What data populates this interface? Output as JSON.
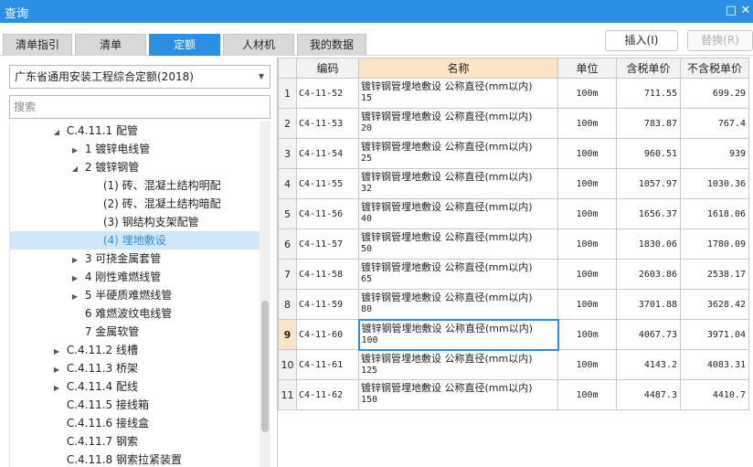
{
  "window": {
    "title": "查询",
    "restore_icon": "□",
    "close_icon": "✕"
  },
  "tabs": [
    {
      "label": "清单指引",
      "active": false
    },
    {
      "label": "清单",
      "active": false
    },
    {
      "label": "定额",
      "active": true
    },
    {
      "label": "人材机",
      "active": false
    },
    {
      "label": "我的数据",
      "active": false
    }
  ],
  "toolbar": {
    "insert_label": "插入(I)",
    "replace_label": "替换(R)"
  },
  "left_panel": {
    "quota_select": "广东省通用安装工程综合定额(2018)",
    "search_placeholder": "搜索",
    "tree": [
      {
        "toggle": "◢",
        "label": "C.4.11.1 配管",
        "level": 0,
        "selected": false
      },
      {
        "toggle": "▶",
        "label": "1 镀锌电线管",
        "level": 1,
        "selected": false
      },
      {
        "toggle": "◢",
        "label": "2 镀锌钢管",
        "level": 1,
        "selected": false
      },
      {
        "toggle": "",
        "label": "(1) 砖、混凝土结构明配",
        "level": 2,
        "selected": false
      },
      {
        "toggle": "",
        "label": "(2) 砖、混凝土结构暗配",
        "level": 2,
        "selected": false
      },
      {
        "toggle": "",
        "label": "(3) 钢结构支架配管",
        "level": 2,
        "selected": false
      },
      {
        "toggle": "",
        "label": "(4) 埋地敷设",
        "level": 2,
        "selected": true
      },
      {
        "toggle": "▶",
        "label": "3 可挠金属套管",
        "level": 1,
        "selected": false
      },
      {
        "toggle": "▶",
        "label": "4 刚性难燃线管",
        "level": 1,
        "selected": false
      },
      {
        "toggle": "▶",
        "label": "5 半硬质难燃线管",
        "level": 1,
        "selected": false
      },
      {
        "toggle": "",
        "label": "6 难燃波纹电线管",
        "level": 1,
        "selected": false
      },
      {
        "toggle": "",
        "label": "7 金属软管",
        "level": 1,
        "selected": false
      },
      {
        "toggle": "▶",
        "label": "C.4.11.2 线槽",
        "level": 0,
        "selected": false
      },
      {
        "toggle": "▶",
        "label": "C.4.11.3 桥架",
        "level": 0,
        "selected": false
      },
      {
        "toggle": "▶",
        "label": "C.4.11.4 配线",
        "level": 0,
        "selected": false
      },
      {
        "toggle": "",
        "label": "C.4.11.5 接线箱",
        "level": 0,
        "selected": false
      },
      {
        "toggle": "",
        "label": "C.4.11.6 接线盒",
        "level": 0,
        "selected": false
      },
      {
        "toggle": "",
        "label": "C.4.11.7 钢索",
        "level": 0,
        "selected": false
      },
      {
        "toggle": "",
        "label": "C.4.11.8 钢索拉紧装置",
        "level": 0,
        "selected": false
      }
    ]
  },
  "grid": {
    "columns": [
      "",
      "编码",
      "名称",
      "单位",
      "含税单价",
      "不含税单价"
    ],
    "current_row": 9,
    "rows": [
      {
        "idx": "1",
        "code": "C4-11-52",
        "name": "镀锌钢管埋地敷设 公称直径(mm以内)",
        "spec": "15",
        "unit": "100m",
        "price_tax": "711.55",
        "price_notax": "699.29"
      },
      {
        "idx": "2",
        "code": "C4-11-53",
        "name": "镀锌钢管埋地敷设 公称直径(mm以内)",
        "spec": "20",
        "unit": "100m",
        "price_tax": "783.87",
        "price_notax": "767.4"
      },
      {
        "idx": "3",
        "code": "C4-11-54",
        "name": "镀锌钢管埋地敷设 公称直径(mm以内)",
        "spec": "25",
        "unit": "100m",
        "price_tax": "960.51",
        "price_notax": "939"
      },
      {
        "idx": "4",
        "code": "C4-11-55",
        "name": "镀锌钢管埋地敷设 公称直径(mm以内)",
        "spec": "32",
        "unit": "100m",
        "price_tax": "1057.97",
        "price_notax": "1030.36"
      },
      {
        "idx": "5",
        "code": "C4-11-56",
        "name": "镀锌钢管埋地敷设 公称直径(mm以内)",
        "spec": "40",
        "unit": "100m",
        "price_tax": "1656.37",
        "price_notax": "1618.06"
      },
      {
        "idx": "6",
        "code": "C4-11-57",
        "name": "镀锌钢管埋地敷设 公称直径(mm以内)",
        "spec": "50",
        "unit": "100m",
        "price_tax": "1830.06",
        "price_notax": "1780.09"
      },
      {
        "idx": "7",
        "code": "C4-11-58",
        "name": "镀锌钢管埋地敷设 公称直径(mm以内)",
        "spec": "65",
        "unit": "100m",
        "price_tax": "2603.86",
        "price_notax": "2538.17"
      },
      {
        "idx": "8",
        "code": "C4-11-59",
        "name": "镀锌钢管埋地敷设 公称直径(mm以内)",
        "spec": "80",
        "unit": "100m",
        "price_tax": "3701.88",
        "price_notax": "3628.42"
      },
      {
        "idx": "9",
        "code": "C4-11-60",
        "name": "镀锌钢管埋地敷设 公称直径(mm以内)",
        "spec": "100",
        "unit": "100m",
        "price_tax": "4067.73",
        "price_notax": "3971.04"
      },
      {
        "idx": "10",
        "code": "C4-11-61",
        "name": "镀锌钢管埋地敷设 公称直径(mm以内)",
        "spec": "125",
        "unit": "100m",
        "price_tax": "4143.2",
        "price_notax": "4083.31"
      },
      {
        "idx": "11",
        "code": "C4-11-62",
        "name": "镀锌钢管埋地敷设 公称直径(mm以内)",
        "spec": "150",
        "unit": "100m",
        "price_tax": "4487.3",
        "price_notax": "4410.7"
      }
    ]
  },
  "colors": {
    "accent": "#2b8fe3",
    "header_highlight": "#fbe5c6",
    "selected_row": "#cfe6fb"
  }
}
